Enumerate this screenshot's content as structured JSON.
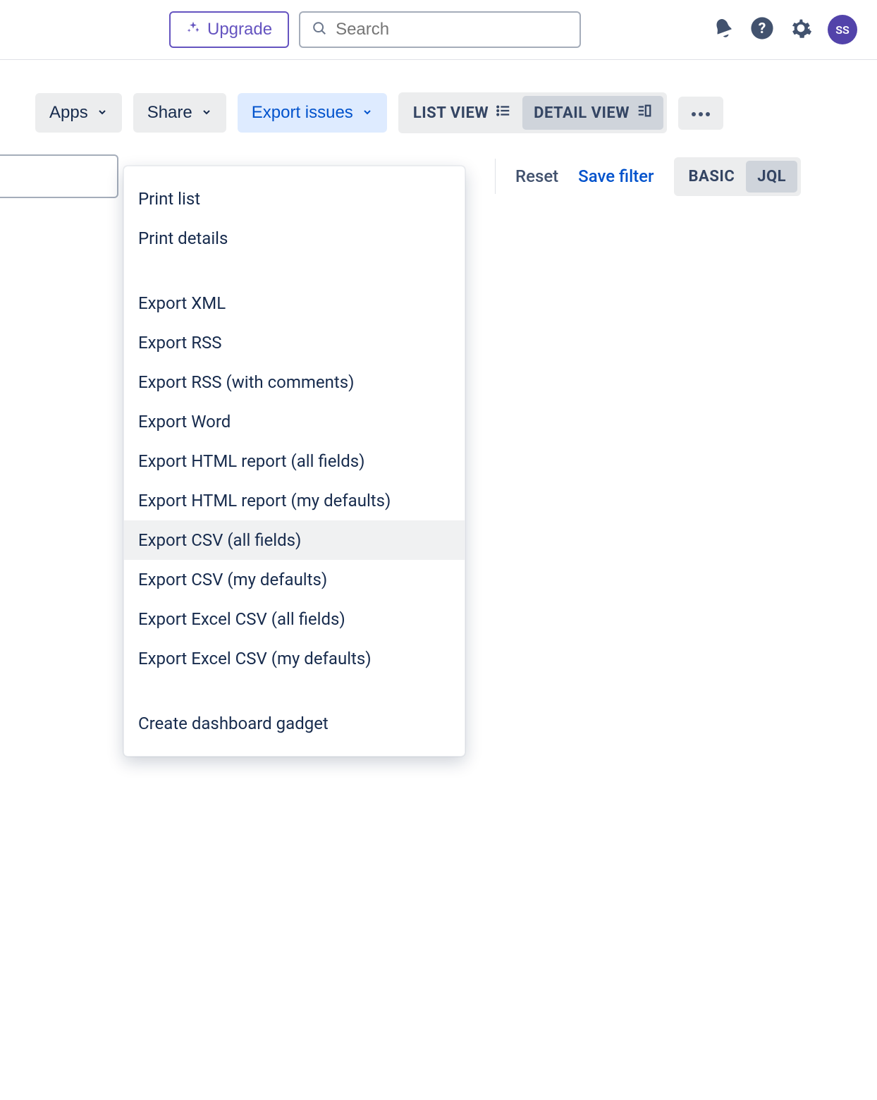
{
  "topbar": {
    "upgrade_label": "Upgrade",
    "search_placeholder": "Search",
    "avatar_initials": "SS"
  },
  "toolbar": {
    "apps_label": "Apps",
    "share_label": "Share",
    "export_label": "Export issues",
    "list_view_label": "LIST VIEW",
    "detail_view_label": "DETAIL VIEW"
  },
  "subbar": {
    "reset_label": "Reset",
    "save_filter_label": "Save filter",
    "basic_label": "BASIC",
    "jql_label": "JQL"
  },
  "export_menu": {
    "print_list": "Print list",
    "print_details": "Print details",
    "export_xml": "Export XML",
    "export_rss": "Export RSS",
    "export_rss_comments": "Export RSS (with comments)",
    "export_word": "Export Word",
    "export_html_all": "Export HTML report (all fields)",
    "export_html_my": "Export HTML report (my defaults)",
    "export_csv_all": "Export CSV (all fields)",
    "export_csv_my": "Export CSV (my defaults)",
    "export_excel_all": "Export Excel CSV (all fields)",
    "export_excel_my": "Export Excel CSV (my defaults)",
    "create_gadget": "Create dashboard gadget"
  }
}
